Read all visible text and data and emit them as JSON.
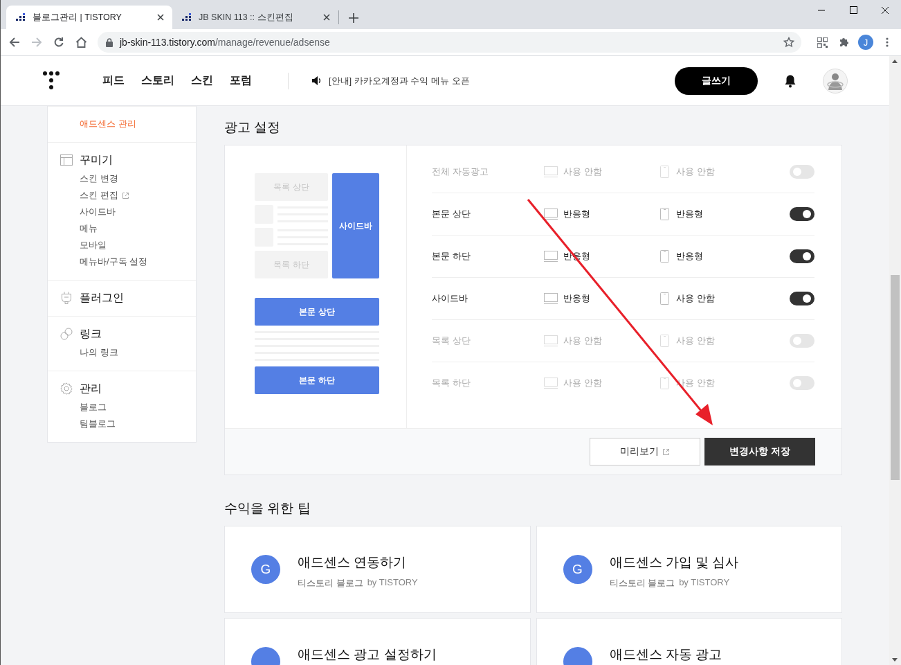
{
  "browser": {
    "tabs": [
      {
        "title": "블로그관리 | TISTORY",
        "selected": true
      },
      {
        "title": "JB SKIN 113 :: 스킨편집",
        "selected": false
      }
    ],
    "url": {
      "host": "jb-skin-113.tistory.com",
      "path": "/manage/revenue/adsense"
    },
    "profile": "J"
  },
  "header": {
    "nav": [
      "피드",
      "스토리",
      "스킨",
      "포럼"
    ],
    "notice": "[안내] 카카오계정과 수익 메뉴 오픈",
    "write_button": "글쓰기"
  },
  "sidebar": {
    "sections": [
      {
        "kind": "none",
        "items": [
          {
            "label": "애드센스 관리",
            "selected": true,
            "external": false
          }
        ]
      },
      {
        "kind": "layout",
        "title": "꾸미기",
        "items": [
          {
            "label": "스킨 변경",
            "selected": false,
            "external": false
          },
          {
            "label": "스킨 편집",
            "selected": false,
            "external": true
          },
          {
            "label": "사이드바",
            "selected": false,
            "external": false
          },
          {
            "label": "메뉴",
            "selected": false,
            "external": false
          },
          {
            "label": "모바일",
            "selected": false,
            "external": false
          },
          {
            "label": "메뉴바/구독 설정",
            "selected": false,
            "external": false
          }
        ]
      },
      {
        "kind": "plugin",
        "title": "플러그인"
      },
      {
        "kind": "link",
        "title": "링크",
        "items": [
          {
            "label": "나의 링크",
            "selected": false,
            "external": false
          }
        ]
      },
      {
        "kind": "gear",
        "title": "관리",
        "items": [
          {
            "label": "블로그",
            "selected": false,
            "external": false
          },
          {
            "label": "팀블로그",
            "selected": false,
            "external": false
          }
        ]
      }
    ]
  },
  "ad_settings": {
    "title": "광고 설정",
    "preview": [
      {
        "label": "목록 상단",
        "on": false
      },
      {
        "label": "사이드바",
        "on": true
      },
      {
        "label": "목록 하단",
        "on": false
      },
      {
        "label": "본문 상단",
        "on": true
      },
      {
        "label": "본문 하단",
        "on": true
      }
    ],
    "rows": [
      {
        "label": "전체 자동광고",
        "pc": "사용 안함",
        "mobile": "사용 안함",
        "on": false
      },
      {
        "label": "본문 상단",
        "pc": "반응형",
        "mobile": "반응형",
        "on": true
      },
      {
        "label": "본문 하단",
        "pc": "반응형",
        "mobile": "반응형",
        "on": true
      },
      {
        "label": "사이드바",
        "pc": "반응형",
        "mobile": "사용 안함",
        "on": true
      },
      {
        "label": "목록 상단",
        "pc": "사용 안함",
        "mobile": "사용 안함",
        "on": false
      },
      {
        "label": "목록 하단",
        "pc": "사용 안함",
        "mobile": "사용 안함",
        "on": false
      }
    ],
    "preview_button": "미리보기",
    "save_button": "변경사항 저장"
  },
  "tips": {
    "title": "수익을 위한 팁",
    "cards": [
      {
        "icon": "G",
        "title": "애드센스 연동하기",
        "source": "티스토리 블로그",
        "by": "by TISTORY"
      },
      {
        "icon": "G",
        "title": "애드센스 가입 및 심사",
        "source": "티스토리 블로그",
        "by": "by TISTORY"
      },
      {
        "title": "애드센스 광고 설정하기"
      },
      {
        "title": "애드센스 자동 광고"
      }
    ]
  }
}
